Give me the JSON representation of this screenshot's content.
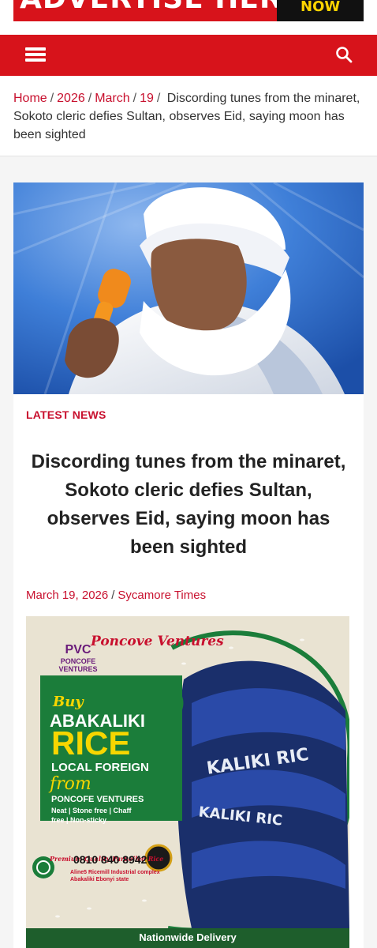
{
  "top_ad": {
    "left_text": "ADVERTISE HERE",
    "right_text": "NOW"
  },
  "navbar": {
    "menu_icon": "hamburger-menu-icon",
    "search_icon": "search-icon",
    "color": "#d7131b"
  },
  "breadcrumb": {
    "items": [
      "Home",
      "2026",
      "March",
      "19"
    ],
    "current": "Discording tunes from the minaret, Sokoto cleric defies Sultan, observes Eid, saying moon has been sighted"
  },
  "article": {
    "category": "LATEST NEWS",
    "title": "Discording tunes from the minaret, Sokoto cleric defies Sultan, observes Eid, saying moon has been sighted",
    "date": "March 19, 2026",
    "author": "Sycamore Times"
  },
  "promo": {
    "brand_script": "Poncove Ventures",
    "brand_short": "PVC",
    "brand_name": "PONCOFE VENTURES",
    "buy": "Buy",
    "line1": "ABAKALIKI",
    "line2": "RICE",
    "line3": "LOCAL FOREIGN",
    "from": "from",
    "company": "PONCOFE VENTURES",
    "tags": "Neat | Stone free | Chaff free | Non-sticky",
    "quality": "Premium Quality Parboiled Rice",
    "phone": "0810 840 8942",
    "address": "Aline5 Ricemill Industrial complex Abakaliki Ebonyi state",
    "delivery": "Nationwide Delivery"
  },
  "colors": {
    "accent": "#c8102e",
    "nav": "#d7131b"
  }
}
